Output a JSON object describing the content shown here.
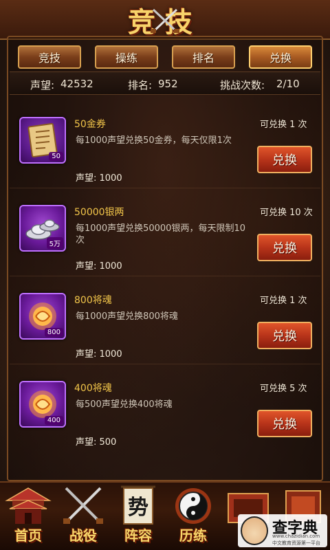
{
  "header": {
    "title": "竞技"
  },
  "tabs": [
    {
      "label": "竞技",
      "active": false
    },
    {
      "label": "操练",
      "active": false
    },
    {
      "label": "排名",
      "active": false
    },
    {
      "label": "兑换",
      "active": true
    }
  ],
  "stats": {
    "reputation_label": "声望:",
    "reputation_value": "42532",
    "rank_label": "排名:",
    "rank_value": "952",
    "challenge_label": "挑战次数:",
    "challenge_value": "2/10"
  },
  "items": [
    {
      "name": "50金券",
      "icon": "gold-ticket-icon",
      "qty": "50",
      "desc": "每1000声望兑换50金券，每天仅限1次",
      "cost": "声望: 1000",
      "count": "可兑换 1 次",
      "button": "兑换"
    },
    {
      "name": "50000银两",
      "icon": "silver-ingot-icon",
      "qty": "5万",
      "desc": "每1000声望兑换50000银两，每天限制10次",
      "cost": "声望: 1000",
      "count": "可兑换 10 次",
      "button": "兑换"
    },
    {
      "name": "800将魂",
      "icon": "general-soul-icon",
      "qty": "800",
      "desc": "每1000声望兑换800将魂",
      "cost": "声望: 1000",
      "count": "可兑换 1 次",
      "button": "兑换"
    },
    {
      "name": "400将魂",
      "icon": "general-soul-icon",
      "qty": "400",
      "desc": "每500声望兑换400将魂",
      "cost": "声望: 500",
      "count": "可兑换 5 次",
      "button": "兑换"
    }
  ],
  "bottom_nav": [
    {
      "label": "首页",
      "icon": "palace-icon"
    },
    {
      "label": "战役",
      "icon": "crossed-swords-icon"
    },
    {
      "label": "阵容",
      "icon": "banner-icon"
    },
    {
      "label": "历练",
      "icon": "yin-yang-icon"
    },
    {
      "label": "",
      "icon": "treasure-chest-icon"
    },
    {
      "label": "",
      "icon": "scroll-icon"
    }
  ],
  "banner_text": "势",
  "watermark": {
    "title": "查字典",
    "url": "www.chazidian.com",
    "subtitle": "中文教育资源第一平台"
  },
  "colors": {
    "accent_gold": "#f2c64a",
    "button_red": "#b8341a",
    "purple_frame": "#6a1a9a"
  }
}
